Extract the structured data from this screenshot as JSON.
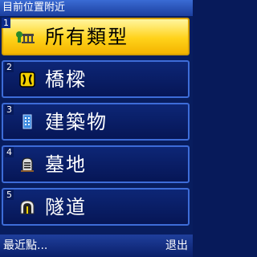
{
  "title": "目前位置附近",
  "items": [
    {
      "num": "1",
      "label": "所有類型",
      "icon": "all-types-icon",
      "selected": true
    },
    {
      "num": "2",
      "label": "橋樑",
      "icon": "bridge-icon",
      "selected": false
    },
    {
      "num": "3",
      "label": "建築物",
      "icon": "building-icon",
      "selected": false
    },
    {
      "num": "4",
      "label": "墓地",
      "icon": "cemetery-icon",
      "selected": false
    },
    {
      "num": "5",
      "label": "隧道",
      "icon": "tunnel-icon",
      "selected": false
    }
  ],
  "softkeys": {
    "left": "最近點...",
    "right": "退出"
  },
  "colors": {
    "background": "#081d5e",
    "selected": "#ffd21a",
    "border": "#3d6cd8"
  }
}
